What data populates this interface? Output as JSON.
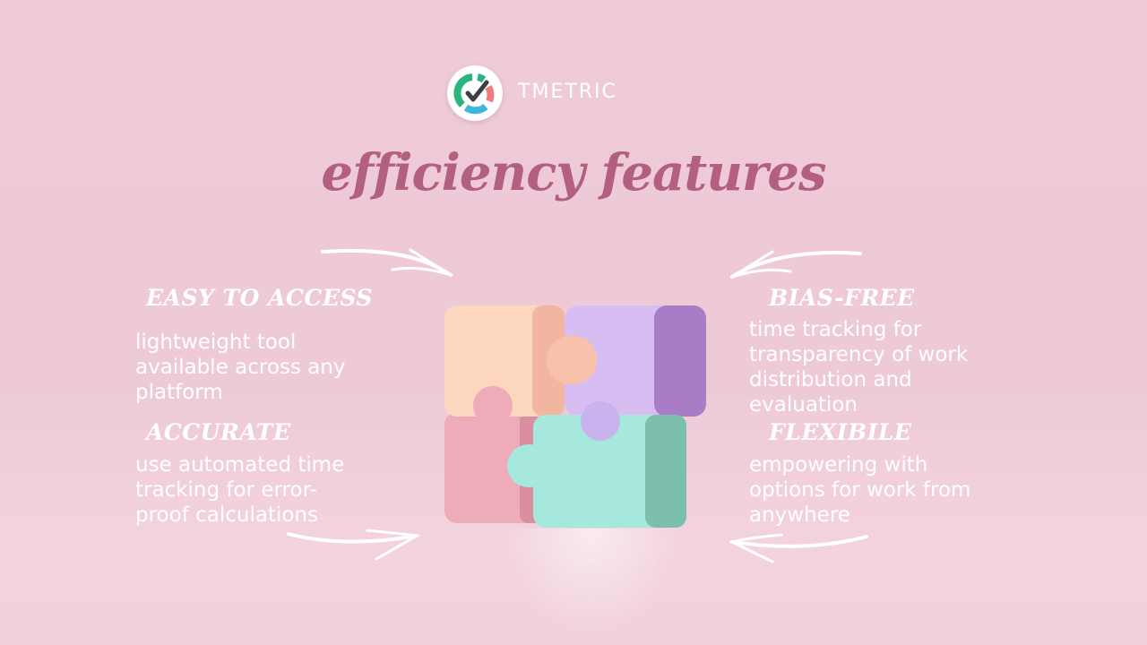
{
  "brand": {
    "name": "TMETRIC",
    "logo_icon": "tmetric-check-gauge-icon",
    "logo_colors": {
      "green": "#2bb57e",
      "blue": "#3fb6db",
      "red": "#ee7c7c",
      "check": "#3d3d45"
    }
  },
  "title": "efficiency features",
  "colors": {
    "background": "#efcbd8",
    "title": "#b35f80",
    "text": "#ffffff",
    "piece_peach": "#fcd6bd",
    "piece_purple": "#d8bdf3",
    "piece_pink": "#eeabb9",
    "piece_mint": "#a6e8dc"
  },
  "features": [
    {
      "heading": "EASY TO ACCESS",
      "lines": [
        "lightweight tool",
        "available across any",
        "platform"
      ]
    },
    {
      "heading": "ACCURATE",
      "lines": [
        "use automated time",
        "tracking for error-",
        "proof calculations"
      ]
    },
    {
      "heading": "BIAS-FREE",
      "lines": [
        "time tracking for",
        "transparency of work",
        "distribution and",
        "evaluation"
      ]
    },
    {
      "heading": "FLEXIBILE",
      "lines": [
        "empowering with",
        "options for work from",
        "anywhere"
      ]
    }
  ],
  "illustration": {
    "icon": "puzzle-pieces-icon",
    "pieces": 4
  }
}
